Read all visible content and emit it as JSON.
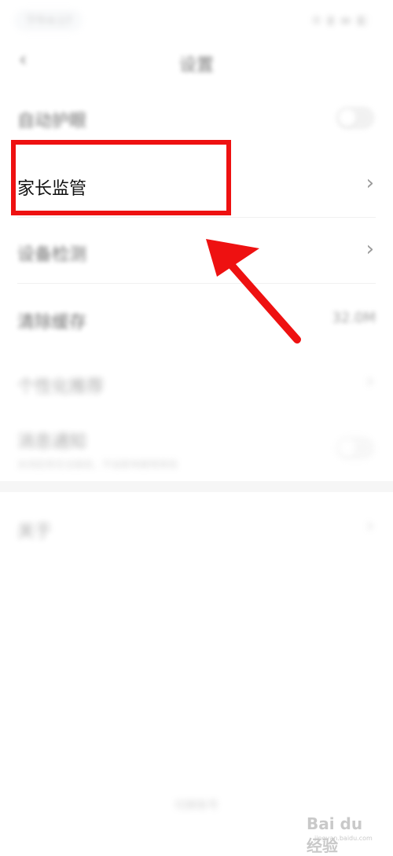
{
  "status_bar": {
    "time": "下午4:17",
    "icons": "⊕ ▮ ▬ ◧"
  },
  "header": {
    "title": "设置"
  },
  "settings": {
    "item1": {
      "label": "自动护眼"
    },
    "parental_control": {
      "label": "家长监管"
    },
    "device_check": {
      "label": "设备检测"
    },
    "clear_cache": {
      "label": "清除缓存",
      "value": "32.0M"
    },
    "item5": {
      "label": "个性化推荐"
    },
    "item6": {
      "label": "消息通知",
      "sub": "关闭后将无法接收，不会影响使用体验"
    },
    "about": {
      "label": "关于"
    }
  },
  "footer": {
    "text": "切换账号"
  },
  "watermark": {
    "logo": "Bai du 经验",
    "sub": "jingyan.baidu.com"
  },
  "colors": {
    "annotation_red": "#ee1111",
    "chevron_gray": "#9a9a9a"
  }
}
